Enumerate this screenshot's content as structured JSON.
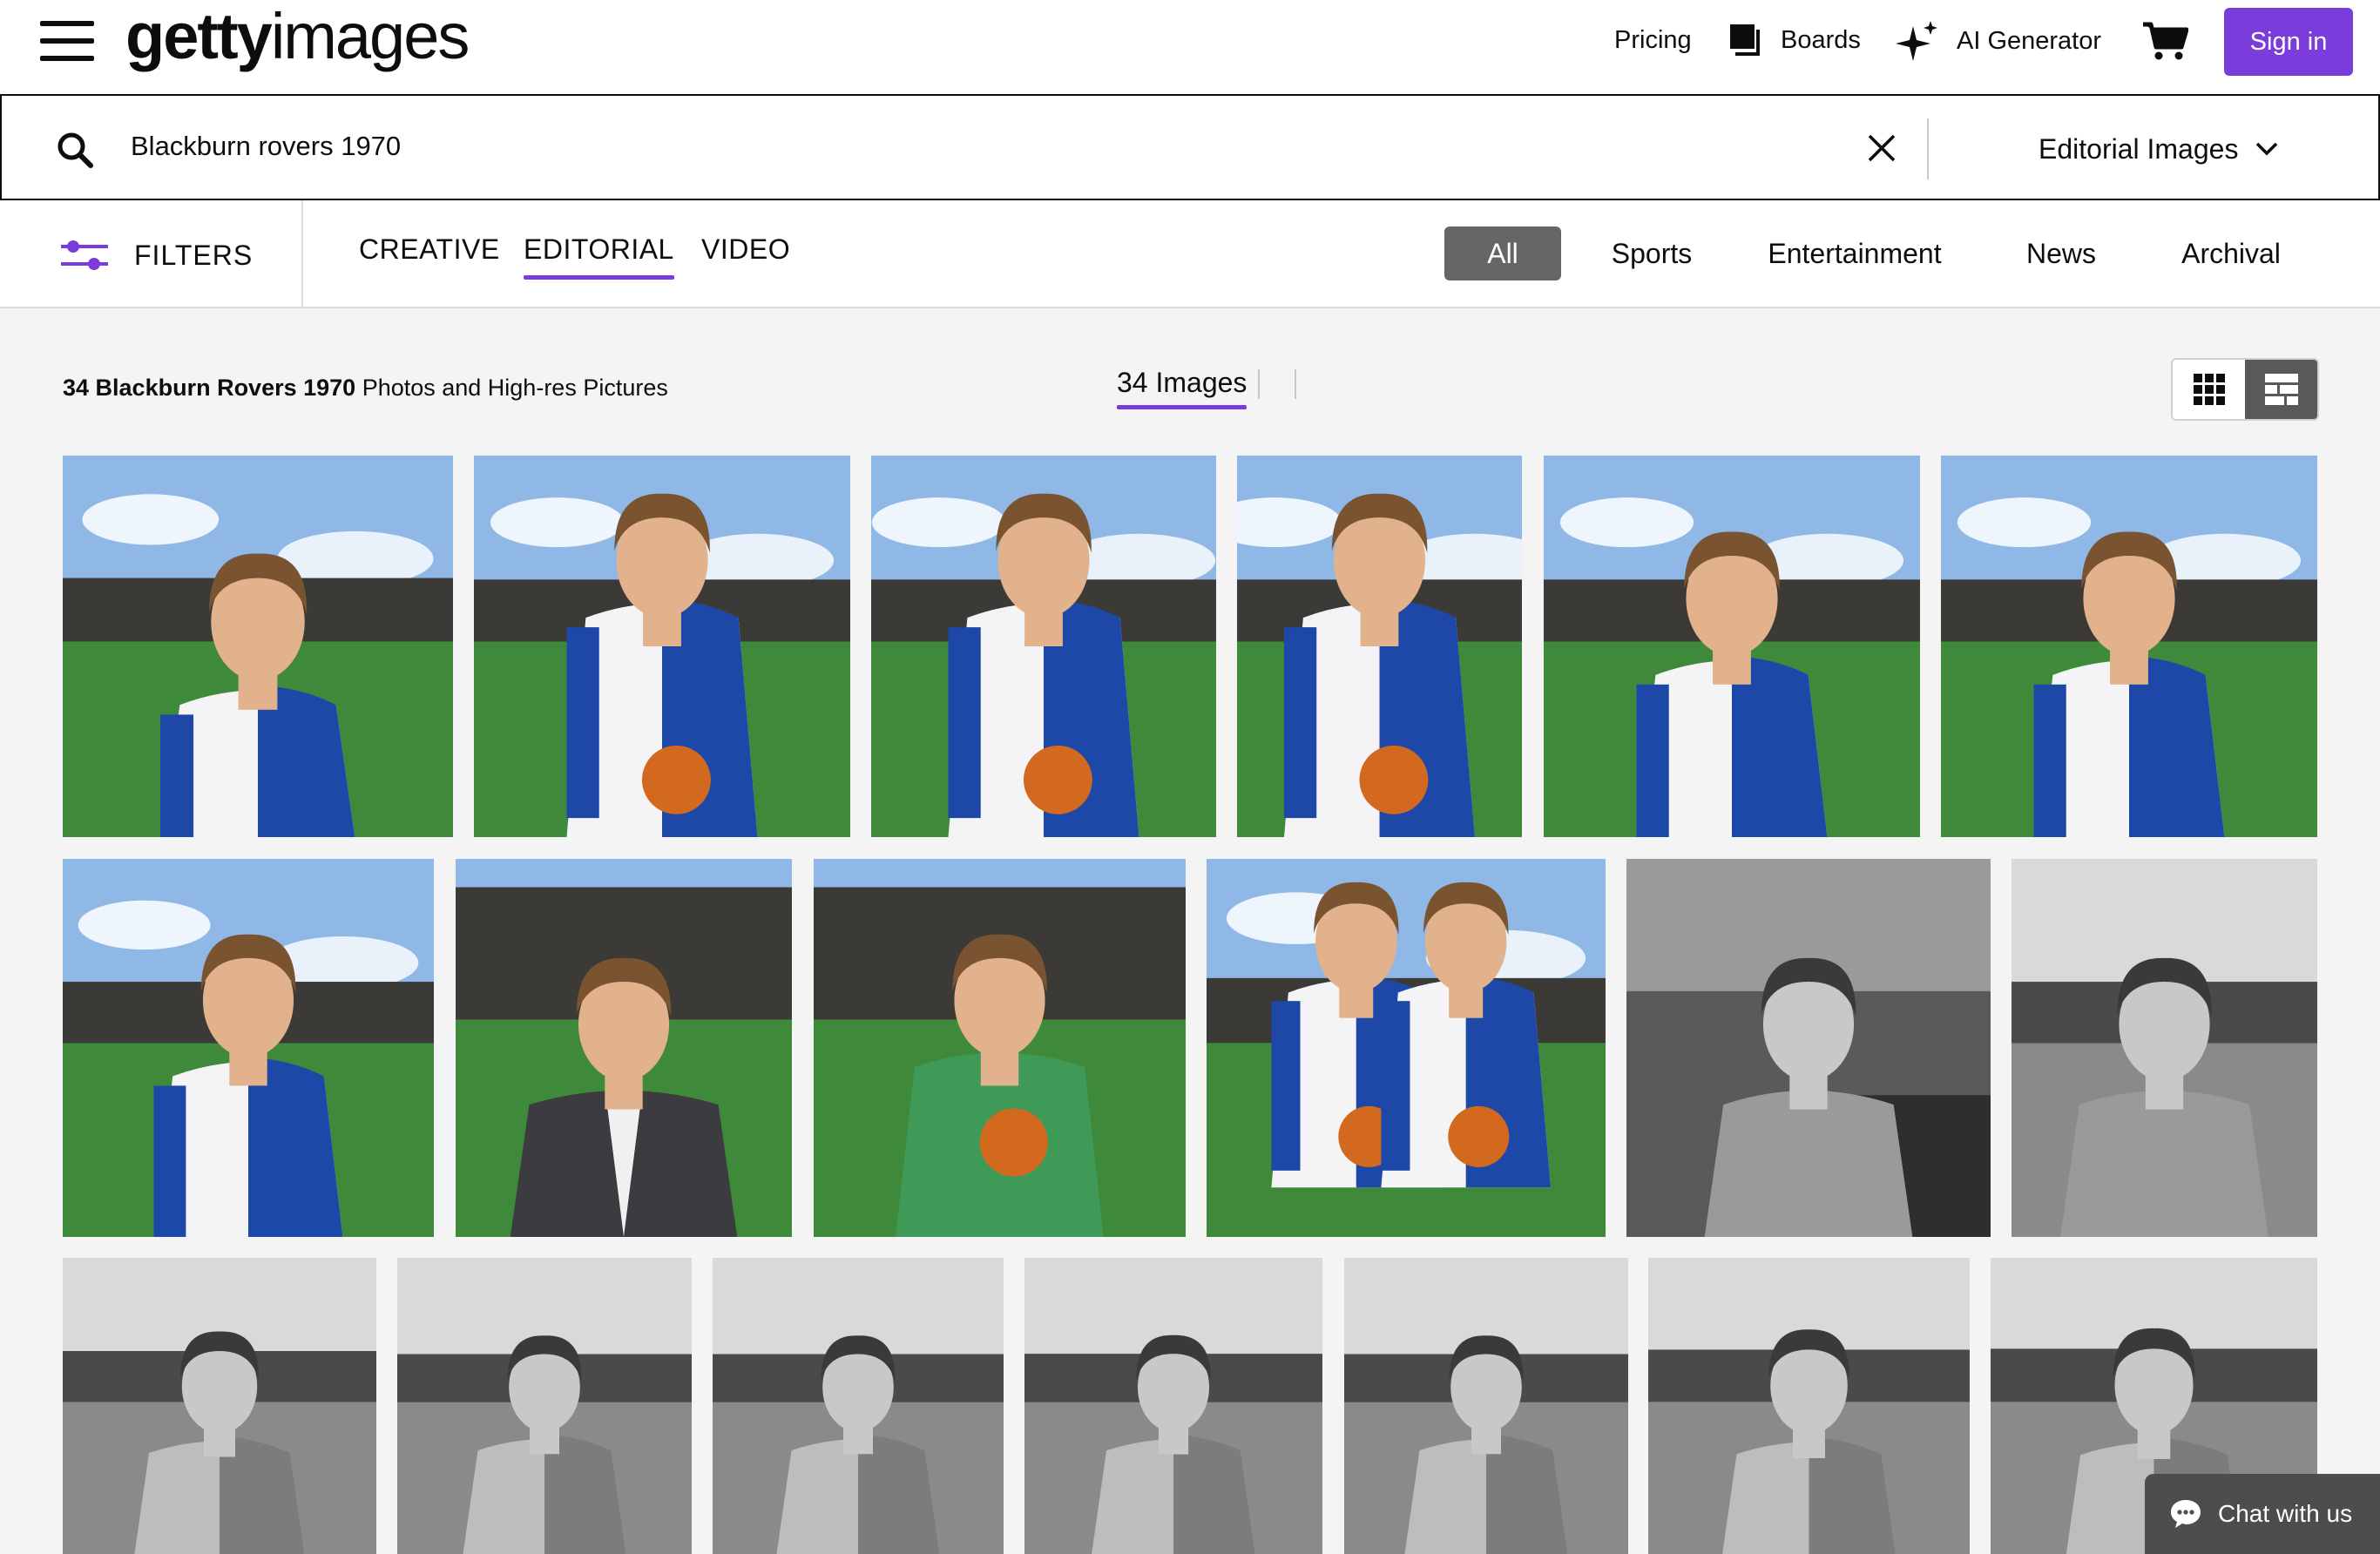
{
  "header": {
    "logo_bold": "getty",
    "logo_light": "images",
    "nav": {
      "pricing": "Pricing",
      "boards": "Boards",
      "ai_generator": "AI Generator",
      "sign_in": "Sign in"
    }
  },
  "search": {
    "query": "Blackburn rovers 1970",
    "type": "Editorial Images"
  },
  "filters": {
    "label": "FILTERS",
    "asset_tabs": [
      "CREATIVE",
      "EDITORIAL",
      "VIDEO"
    ],
    "active_asset_tab": "EDITORIAL",
    "categories": [
      "All",
      "Sports",
      "Entertainment",
      "News",
      "Archival"
    ],
    "active_category": "All"
  },
  "results": {
    "title_bold": "34 Blackburn Rovers 1970",
    "title_rest": " Photos and High-res Pictures",
    "count_tab": "34 Images",
    "view_mode": "mosaic"
  },
  "images": [
    {
      "tone": "color",
      "kit": "blue-white",
      "pose": "portrait"
    },
    {
      "tone": "color",
      "kit": "blue-white",
      "pose": "kneeling-ball"
    },
    {
      "tone": "color",
      "kit": "blue-white",
      "pose": "kneeling-ball"
    },
    {
      "tone": "color",
      "kit": "blue-white",
      "pose": "kneeling-ball"
    },
    {
      "tone": "color",
      "kit": "blue-white",
      "pose": "arms-crossed"
    },
    {
      "tone": "color",
      "kit": "blue-white",
      "pose": "arms-crossed"
    },
    {
      "tone": "color",
      "kit": "blue-white",
      "pose": "arms-crossed"
    },
    {
      "tone": "color",
      "kit": "suit",
      "pose": "portrait"
    },
    {
      "tone": "color",
      "kit": "green-keeper",
      "pose": "holding-ball"
    },
    {
      "tone": "color",
      "kit": "blue-white",
      "pose": "two-players"
    },
    {
      "tone": "bw",
      "kit": "sweater",
      "pose": "bar"
    },
    {
      "tone": "bw",
      "kit": "sweater",
      "pose": "portrait"
    },
    {
      "tone": "bw",
      "kit": "halves",
      "pose": "portrait"
    },
    {
      "tone": "bw",
      "kit": "halves",
      "pose": "portrait"
    },
    {
      "tone": "bw",
      "kit": "halves",
      "pose": "portrait"
    },
    {
      "tone": "bw",
      "kit": "halves",
      "pose": "portrait"
    },
    {
      "tone": "bw",
      "kit": "halves",
      "pose": "portrait"
    },
    {
      "tone": "bw",
      "kit": "halves",
      "pose": "portrait"
    },
    {
      "tone": "bw",
      "kit": "halves",
      "pose": "portrait"
    }
  ],
  "chat": {
    "label": "Chat with us"
  },
  "colors": {
    "accent": "#7a3ddc",
    "active_pill": "#666666",
    "chat_bg": "#4d4d4d"
  }
}
